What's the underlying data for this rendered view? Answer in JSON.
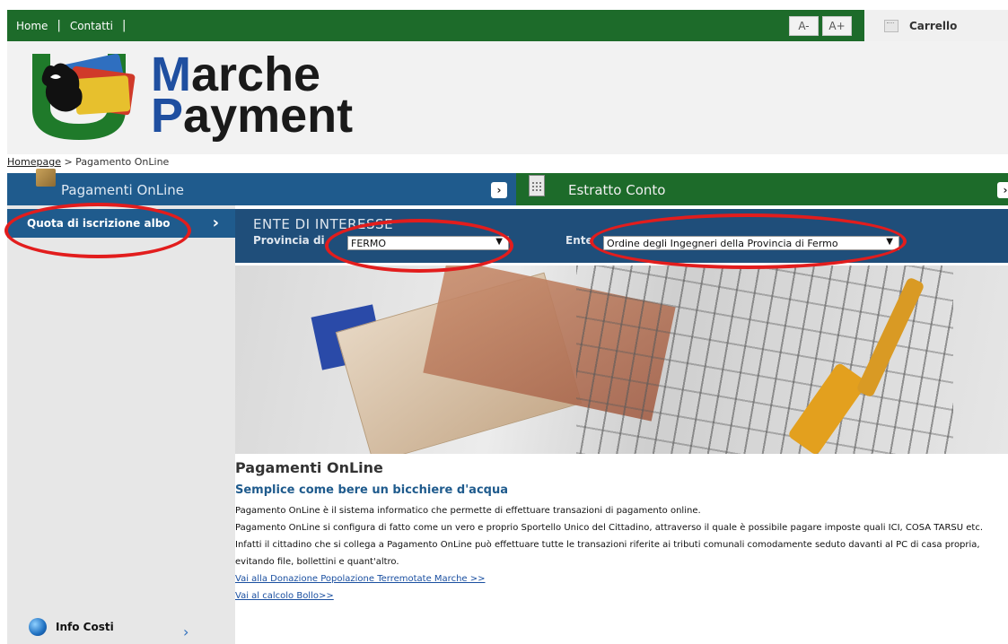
{
  "topbar": {
    "home": "Home",
    "contatti": "Contatti",
    "font_minus": "A-",
    "font_plus": "A+",
    "carrello": "Carrello"
  },
  "logo": {
    "line1_cap": "M",
    "line1_rest": "arche",
    "line2_cap": "P",
    "line2_rest": "ayment"
  },
  "breadcrumb": {
    "home": "Homepage",
    "current": " > Pagamento OnLine"
  },
  "tabs": {
    "pagamenti": "Pagamenti OnLine",
    "estratto": "Estratto Conto"
  },
  "sidebar": {
    "quota": "Quota di iscrizione albo",
    "info_costi": "Info Costi"
  },
  "ente": {
    "title": "ENTE DI INTERESSE",
    "provincia_label": "Provincia di",
    "provincia_value": "FERMO",
    "ente_label": "Ente",
    "ente_value": "Ordine degli Ingegneri della Provincia di Fermo"
  },
  "content": {
    "title": "Pagamenti OnLine",
    "subtitle": "Semplice come bere un bicchiere d'acqua",
    "p1": "Pagamento OnLine è il sistema informatico che permette di effettuare transazioni di pagamento online.",
    "p2": "Pagamento OnLine si configura di fatto come un vero e proprio Sportello Unico del Cittadino, attraverso il quale è possibile pagare imposte quali ICI, COSA TARSU etc.",
    "p3": "Infatti il cittadino che si collega a Pagamento OnLine può effettuare tutte le transazioni riferite ai tributi comunali comodamente seduto davanti al PC di casa propria, evitando file, bollettini e quant'altro.",
    "link1": "Vai alla Donazione Popolazione Terremotate Marche >>",
    "link2": "Vai al calcolo Bollo>>"
  },
  "colors": {
    "green": "#1d6b2a",
    "blue": "#1f5b8d",
    "annotation_red": "#e21d1d"
  }
}
